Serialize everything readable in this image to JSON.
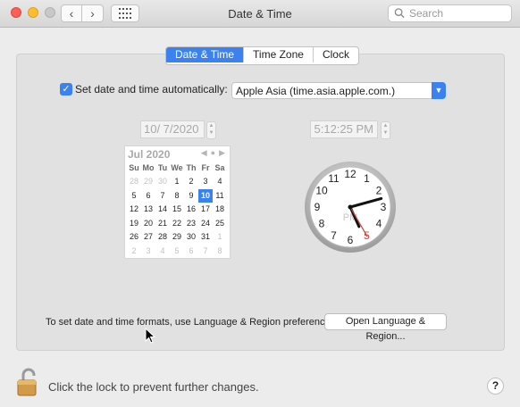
{
  "window": {
    "title": "Date & Time"
  },
  "search": {
    "placeholder": "Search",
    "icon": "search-icon"
  },
  "tabs": [
    {
      "label": "Date & Time",
      "active": true
    },
    {
      "label": "Time Zone",
      "active": false
    },
    {
      "label": "Clock",
      "active": false
    }
  ],
  "auto": {
    "label": "Set date and time automatically:",
    "checked": true,
    "server": "Apple Asia (time.asia.apple.com.)"
  },
  "date_field": "10/  7/2020",
  "time_field": "5:12:25 PM",
  "calendar": {
    "month_label": "Jul 2020",
    "weekdays": [
      "Su",
      "Mo",
      "Tu",
      "We",
      "Th",
      "Fr",
      "Sa"
    ],
    "weeks": [
      [
        "28",
        "29",
        "30",
        "1",
        "2",
        "3",
        "4"
      ],
      [
        "5",
        "6",
        "7",
        "8",
        "9",
        "10",
        "11"
      ],
      [
        "12",
        "13",
        "14",
        "15",
        "16",
        "17",
        "18"
      ],
      [
        "19",
        "20",
        "21",
        "22",
        "23",
        "24",
        "25"
      ],
      [
        "26",
        "27",
        "28",
        "29",
        "30",
        "31",
        "1"
      ],
      [
        "2",
        "3",
        "4",
        "5",
        "6",
        "7",
        "8"
      ]
    ],
    "dim_days": [
      [
        0,
        0
      ],
      [
        0,
        1
      ],
      [
        0,
        2
      ],
      [
        4,
        6
      ],
      [
        5,
        0
      ],
      [
        5,
        1
      ],
      [
        5,
        2
      ],
      [
        5,
        3
      ],
      [
        5,
        4
      ],
      [
        5,
        5
      ],
      [
        5,
        6
      ]
    ],
    "selected": [
      1,
      5
    ]
  },
  "clock": {
    "numbers": [
      "12",
      "1",
      "2",
      "3",
      "4",
      "5",
      "6",
      "7",
      "8",
      "9",
      "10",
      "11"
    ],
    "ampm": "PM",
    "hour": 5,
    "minute": 12,
    "second": 25
  },
  "formats": {
    "hint": "To set date and time formats, use Language & Region preferences.",
    "button": "Open Language & Region..."
  },
  "lock": {
    "text": "Click the lock to prevent further changes."
  },
  "help": {
    "label": "?"
  },
  "colors": {
    "accent": "#3b82f0",
    "second_hand": "#c8443c"
  }
}
